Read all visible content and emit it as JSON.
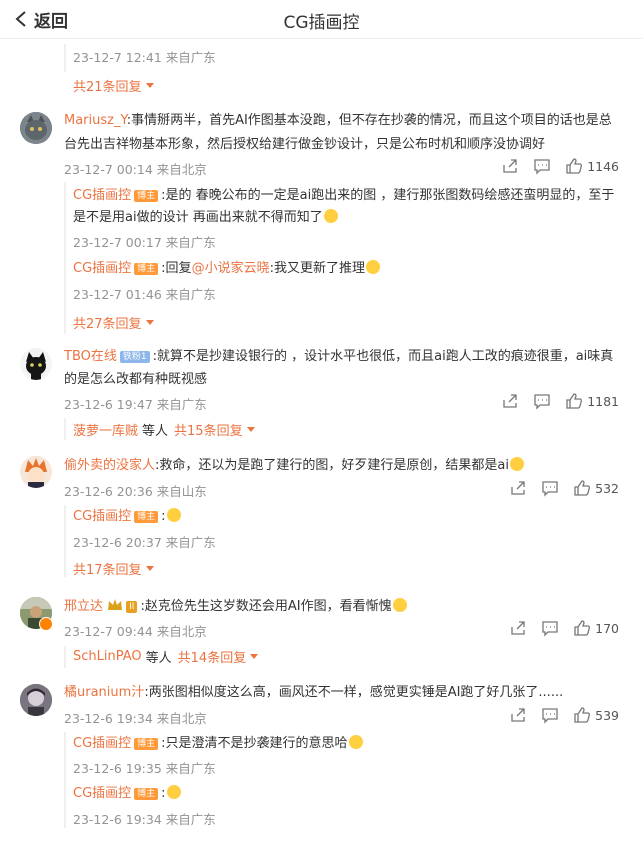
{
  "header": {
    "back_label": "返回",
    "title": "CG插画控"
  },
  "badges": {
    "blogger": "博主",
    "fans": "铁粉1"
  },
  "top_block": {
    "time": "23-12-7 12:41 来自广东",
    "more": "共21条回复"
  },
  "comments": [
    {
      "user": "Mariusz_Y",
      "text_line1": ":事情掰两半，首先AI作图基本没跑，但不存在抄袭的情况，而且这个项目的话也是总",
      "text_line2": "台先出吉祥物基本形象，然后授权给建行做金钞设计，只是公布时机和顺序没协调好",
      "time": "23-12-7 00:14 来自北京",
      "likes": "1146",
      "replies": [
        {
          "user": "CG插画控",
          "text_line1": ":是的 春晚公布的一定是ai跑出来的图 ，建行那张图数码绘感还蛮明显的，至于",
          "text_line2": "是不是用ai做的设计 再画出来就不得而知了",
          "time": "23-12-7 00:17 来自广东"
        },
        {
          "user": "CG插画控",
          "prefix": ":回复",
          "mention": "@小说家云晓",
          "text_line1": ":我又更新了推理",
          "time": "23-12-7 01:46 来自广东"
        }
      ],
      "more": "共27条回复"
    },
    {
      "user": "TBO在线",
      "text_line1": ":就算不是抄建设银行的 ，设计水平也很低，而且ai跑人工改的痕迹很重，ai味真",
      "text_line2": "的是怎么改都有种既视感",
      "time": "23-12-6 19:47 来自广东",
      "likes": "1181",
      "more_user": "菠萝一库贼",
      "more_mid": "等人",
      "more": "共15条回复"
    },
    {
      "user": "偷外卖的没家人",
      "text_line1": ":救命，还以为是跑了建行的图，好歹建行是原创，结果都是ai",
      "time": "23-12-6 20:36 来自山东",
      "likes": "532",
      "replies": [
        {
          "user": "CG插画控",
          "text_line1": ":",
          "time": "23-12-6 20:37 来自广东"
        }
      ],
      "more": "共17条回复"
    },
    {
      "user": "邢立达",
      "level": "II",
      "text_line1": ":赵克俭先生这岁数还会用AI作图，看看惭愧",
      "time": "23-12-7 09:44 来自北京",
      "likes": "170",
      "more_user": "SchLinPAO",
      "more_mid": "等人",
      "more": "共14条回复"
    },
    {
      "user": "橘uranium汁",
      "text_line1": ":两张图相似度这么高，画风还不一样，感觉更实锤是AI跑了好几张了......",
      "time": "23-12-6 19:34 来自北京",
      "likes": "539",
      "replies": [
        {
          "user": "CG插画控",
          "text_line1": ":只是澄清不是抄袭建行的意思哈",
          "time": "23-12-6 19:35 来自广东"
        },
        {
          "user": "CG插画控",
          "text_line1": ":",
          "time": "23-12-6 19:34 来自广东"
        }
      ]
    }
  ],
  "colors": {
    "accent": "#eb7340",
    "meta": "#939393",
    "badge": "#ff9a3a"
  },
  "icons": [
    "back-chevron-icon",
    "share-icon",
    "comment-icon",
    "like-icon",
    "more-triangle-icon"
  ]
}
